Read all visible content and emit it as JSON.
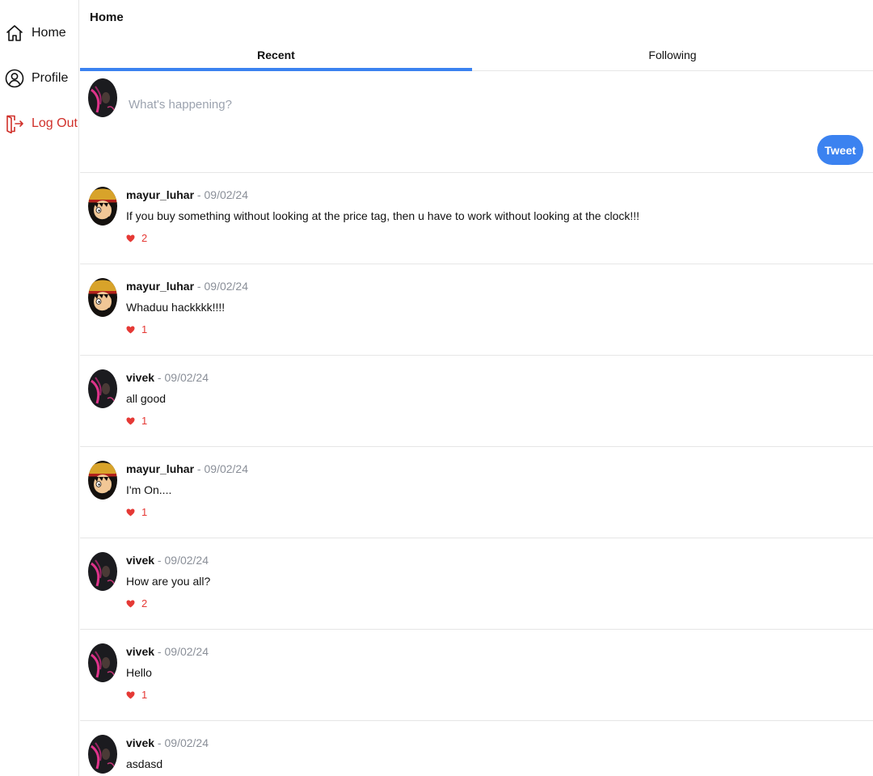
{
  "sidebar": {
    "items": [
      {
        "label": "Home",
        "icon": "home-icon"
      },
      {
        "label": "Profile",
        "icon": "user-icon"
      },
      {
        "label": "Log Out",
        "icon": "logout-icon"
      }
    ]
  },
  "header": {
    "title": "Home"
  },
  "tabs": [
    {
      "label": "Recent",
      "active": true
    },
    {
      "label": "Following",
      "active": false
    }
  ],
  "compose": {
    "placeholder": "What's happening?",
    "button_label": "Tweet"
  },
  "posts": [
    {
      "username": "mayur_luhar",
      "sep": " - ",
      "date": "09/02/24",
      "text": "If you buy something without looking at the price tag, then u have to work without looking at the clock!!!",
      "likes": "2"
    },
    {
      "username": "mayur_luhar",
      "sep": " - ",
      "date": "09/02/24",
      "text": "Whaduu hackkkk!!!!",
      "likes": "1"
    },
    {
      "username": "vivek",
      "sep": " - ",
      "date": "09/02/24",
      "text": "all good",
      "likes": "1"
    },
    {
      "username": "mayur_luhar",
      "sep": " - ",
      "date": "09/02/24",
      "text": "I'm On....",
      "likes": "1"
    },
    {
      "username": "vivek",
      "sep": " - ",
      "date": "09/02/24",
      "text": "How are you all?",
      "likes": "2"
    },
    {
      "username": "vivek",
      "sep": " - ",
      "date": "09/02/24",
      "text": "Hello",
      "likes": "1"
    },
    {
      "username": "vivek",
      "sep": " - ",
      "date": "09/02/24",
      "text": "asdasd",
      "likes": ""
    }
  ],
  "colors": {
    "accent": "#3b82f0",
    "logout": "#d0302a",
    "like": "#e53935",
    "muted": "#8a8f98"
  }
}
